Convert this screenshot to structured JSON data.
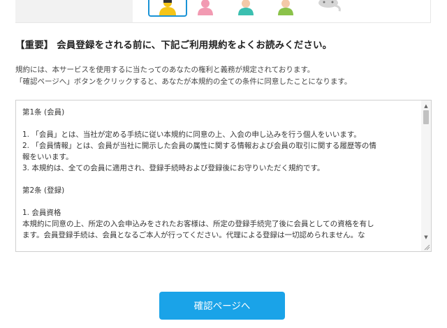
{
  "avatars": {
    "icons": [
      "avatar-yellow-icon",
      "avatar-pink-icon",
      "avatar-teal-icon",
      "avatar-green-icon",
      "avatar-cat-icon"
    ],
    "colors": {
      "yellow": "#f5c518",
      "pink": "#f29ab2",
      "teal": "#3bbfb0",
      "green": "#8bc24a",
      "cat": "#d5d5d5",
      "selected_border": "#1a93d6"
    }
  },
  "notice": {
    "heading": "【重要】 会員登録をされる前に、下記ご利用規約をよくお読みください。",
    "line1": "規約には、本サービスを使用するに当たってのあなたの権利と義務が規定されております。",
    "line2": "「確認ページへ」ボタンをクリックすると、あなたが本規約の全ての条件に同意したことになります。"
  },
  "terms": {
    "lines": [
      "第1条 (会員)",
      "",
      "1. 「会員」とは、当社が定める手続に従い本規約に同意の上、入会の申し込みを行う個人をいいます。",
      "2. 「会員情報」とは、会員が当社に開示した会員の属性に関する情報および会員の取引に関する履歴等の情",
      "報をいいます。",
      "3. 本規約は、全ての会員に適用され、登録手続時および登録後にお守りいただく規約です。",
      "",
      "第2条 (登録)",
      "",
      "1. 会員資格",
      "本規約に同意の上、所定の入会申込みをされたお客様は、所定の登録手続完了後に会員としての資格を有し",
      "ます。会員登録手続は、会員となるご本人が行ってください。代理による登録は一切認められません。な"
    ]
  },
  "actions": {
    "confirm_label": "確認ページへ",
    "accent_color": "#1aa3e8"
  }
}
